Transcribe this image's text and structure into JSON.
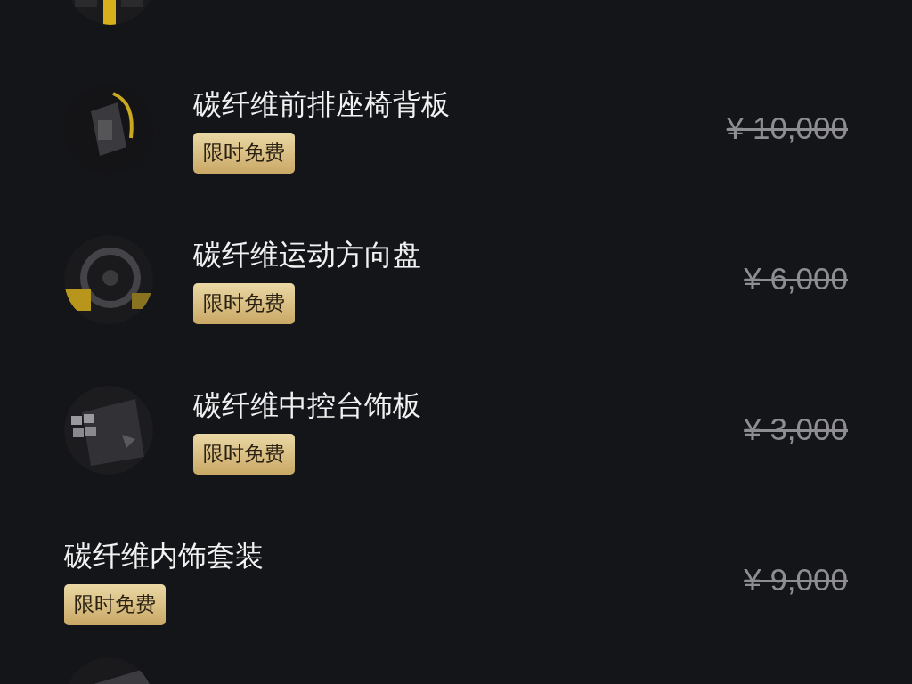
{
  "items": [
    {
      "kind": "thumb",
      "title": "碳纤维前排座椅背板",
      "badge": "限时免费",
      "price": "¥ 10,000"
    },
    {
      "kind": "thumb",
      "title": "碳纤维运动方向盘",
      "badge": "限时免费",
      "price": "¥ 6,000"
    },
    {
      "kind": "thumb",
      "title": "碳纤维中控台饰板",
      "badge": "限时免费",
      "price": "¥ 3,000"
    },
    {
      "kind": "plain",
      "title": "碳纤维内饰套装",
      "badge": "限时免费",
      "price": "¥ 9,000"
    }
  ]
}
